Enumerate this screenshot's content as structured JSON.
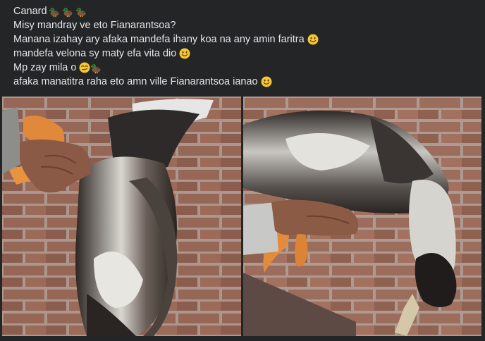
{
  "post": {
    "lines": [
      {
        "text": "Canard",
        "emojis": [
          "duck-icon",
          "duck-icon",
          "duck-icon"
        ]
      },
      {
        "text": "Misy mandray ve eto Fianarantsoa?",
        "emojis": []
      },
      {
        "text": "Manana izahay ary afaka mandefa ihany koa na any amin faritra",
        "emojis": [
          "smiley-icon"
        ]
      },
      {
        "text": "mandefa velona sy maty efa vita dio",
        "emojis": [
          "smiley-icon"
        ]
      },
      {
        "text": "Mp zay mila o",
        "emojis": [
          "smirk-icon",
          "duck-icon"
        ]
      },
      {
        "text": "afaka manatitra raha eto amn ville Fianarantsoa ianao",
        "emojis": [
          "smiley-icon"
        ]
      }
    ]
  },
  "photos": [
    {
      "name": "photo-duck-held-by-feet",
      "subject": "duck-held-upside-down"
    },
    {
      "name": "photo-duck-held-by-body",
      "subject": "duck-held-sideways"
    }
  ],
  "colors": {
    "background": "#242526",
    "text": "#e4e6eb",
    "brick": "#9a6a5a",
    "mortar": "#b9aaa2",
    "duck_dark": "#3a3330",
    "duck_light": "#d8d6d2",
    "feet": "#e08a3a",
    "hand": "#8a5a45"
  }
}
